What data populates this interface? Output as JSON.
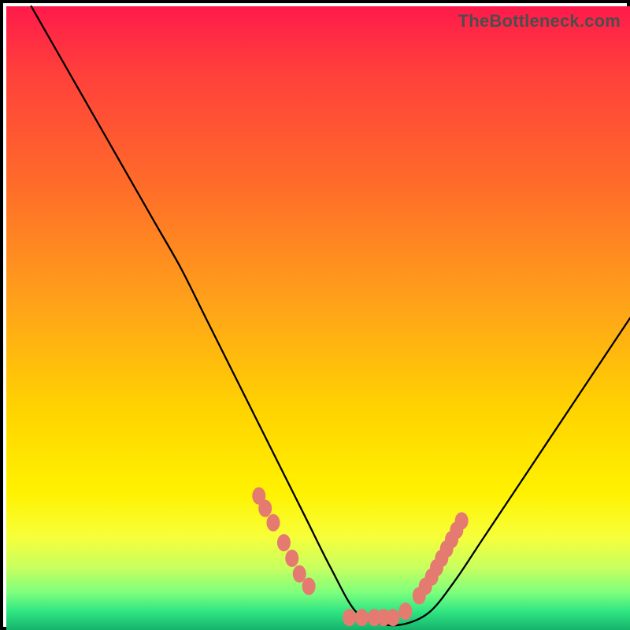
{
  "watermark": "TheBottleneck.com",
  "chart_data": {
    "type": "line",
    "title": "",
    "xlabel": "",
    "ylabel": "",
    "xlim": [
      0,
      100
    ],
    "ylim": [
      0,
      100
    ],
    "grid": false,
    "legend": false,
    "series": [
      {
        "name": "bottleneck-curve",
        "x": [
          4,
          8,
          12,
          16,
          20,
          24,
          28,
          32,
          36,
          40,
          44,
          48,
          52,
          56,
          60,
          64,
          68,
          72,
          76,
          80,
          84,
          88,
          92,
          96,
          100
        ],
        "y": [
          100,
          93,
          86,
          79,
          72,
          65,
          58,
          50,
          42,
          34,
          26,
          18,
          10,
          3,
          1,
          1,
          3,
          8,
          14,
          20,
          26,
          32,
          38,
          44,
          50
        ]
      }
    ],
    "markers": {
      "name": "highlight-dots",
      "x": [
        40.5,
        41.5,
        42.8,
        44.5,
        45.8,
        47.0,
        48.5,
        55.0,
        57.0,
        59.0,
        60.5,
        62.0,
        64.0,
        66.2,
        67.2,
        68.2,
        69.0,
        69.8,
        70.6,
        71.4,
        72.2,
        73.0
      ],
      "y": [
        21.5,
        19.5,
        17.2,
        14.0,
        11.5,
        9.0,
        7.0,
        2.0,
        2.0,
        2.0,
        2.0,
        2.0,
        3.0,
        5.5,
        7.0,
        8.5,
        10.0,
        11.5,
        13.0,
        14.5,
        16.0,
        17.5
      ]
    },
    "background_gradient": {
      "top": "#ff1a4b",
      "mid": "#ffd400",
      "bottom": "#16b36c"
    }
  }
}
